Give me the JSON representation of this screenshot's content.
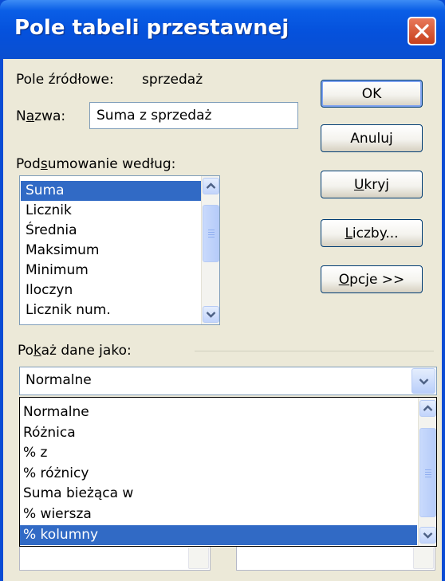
{
  "window": {
    "title": "Pole tabeli przestawnej"
  },
  "source_field": {
    "label": "Pole źródłowe:",
    "value": "sprzedaż"
  },
  "name_field": {
    "label_prefix": "N",
    "label_underlined": "a",
    "label_suffix": "zwa:",
    "value": "Suma z sprzedaż"
  },
  "summarize": {
    "label_prefix": "Pod",
    "label_underlined": "s",
    "label_suffix": "umowanie według:",
    "items": [
      "Suma",
      "Licznik",
      "Średnia",
      "Maksimum",
      "Minimum",
      "Iloczyn",
      "Licznik num."
    ],
    "selected_index": 0
  },
  "buttons": {
    "ok": {
      "label": "OK"
    },
    "cancel": {
      "label": "Anuluj"
    },
    "hide": {
      "pre": "",
      "ul": "U",
      "post": "kryj"
    },
    "numbers": {
      "pre": "",
      "ul": "L",
      "post": "iczby..."
    },
    "options": {
      "pre": "",
      "ul": "O",
      "post": "pcje >>"
    }
  },
  "show_data_as": {
    "label_prefix": "Po",
    "label_underlined": "k",
    "label_suffix": "aż dane jako:",
    "value": "Normalne",
    "options": [
      "Normalne",
      "Różnica",
      "% z",
      "% różnicy",
      "Suma bieżąca w",
      "% wiersza",
      "% kolumny"
    ],
    "highlighted_index": 6
  },
  "colors": {
    "titlebar": "#0a5ee6",
    "selection": "#316ac5",
    "dialog_bg": "#ece9d8",
    "close_button": "#d9562f"
  }
}
